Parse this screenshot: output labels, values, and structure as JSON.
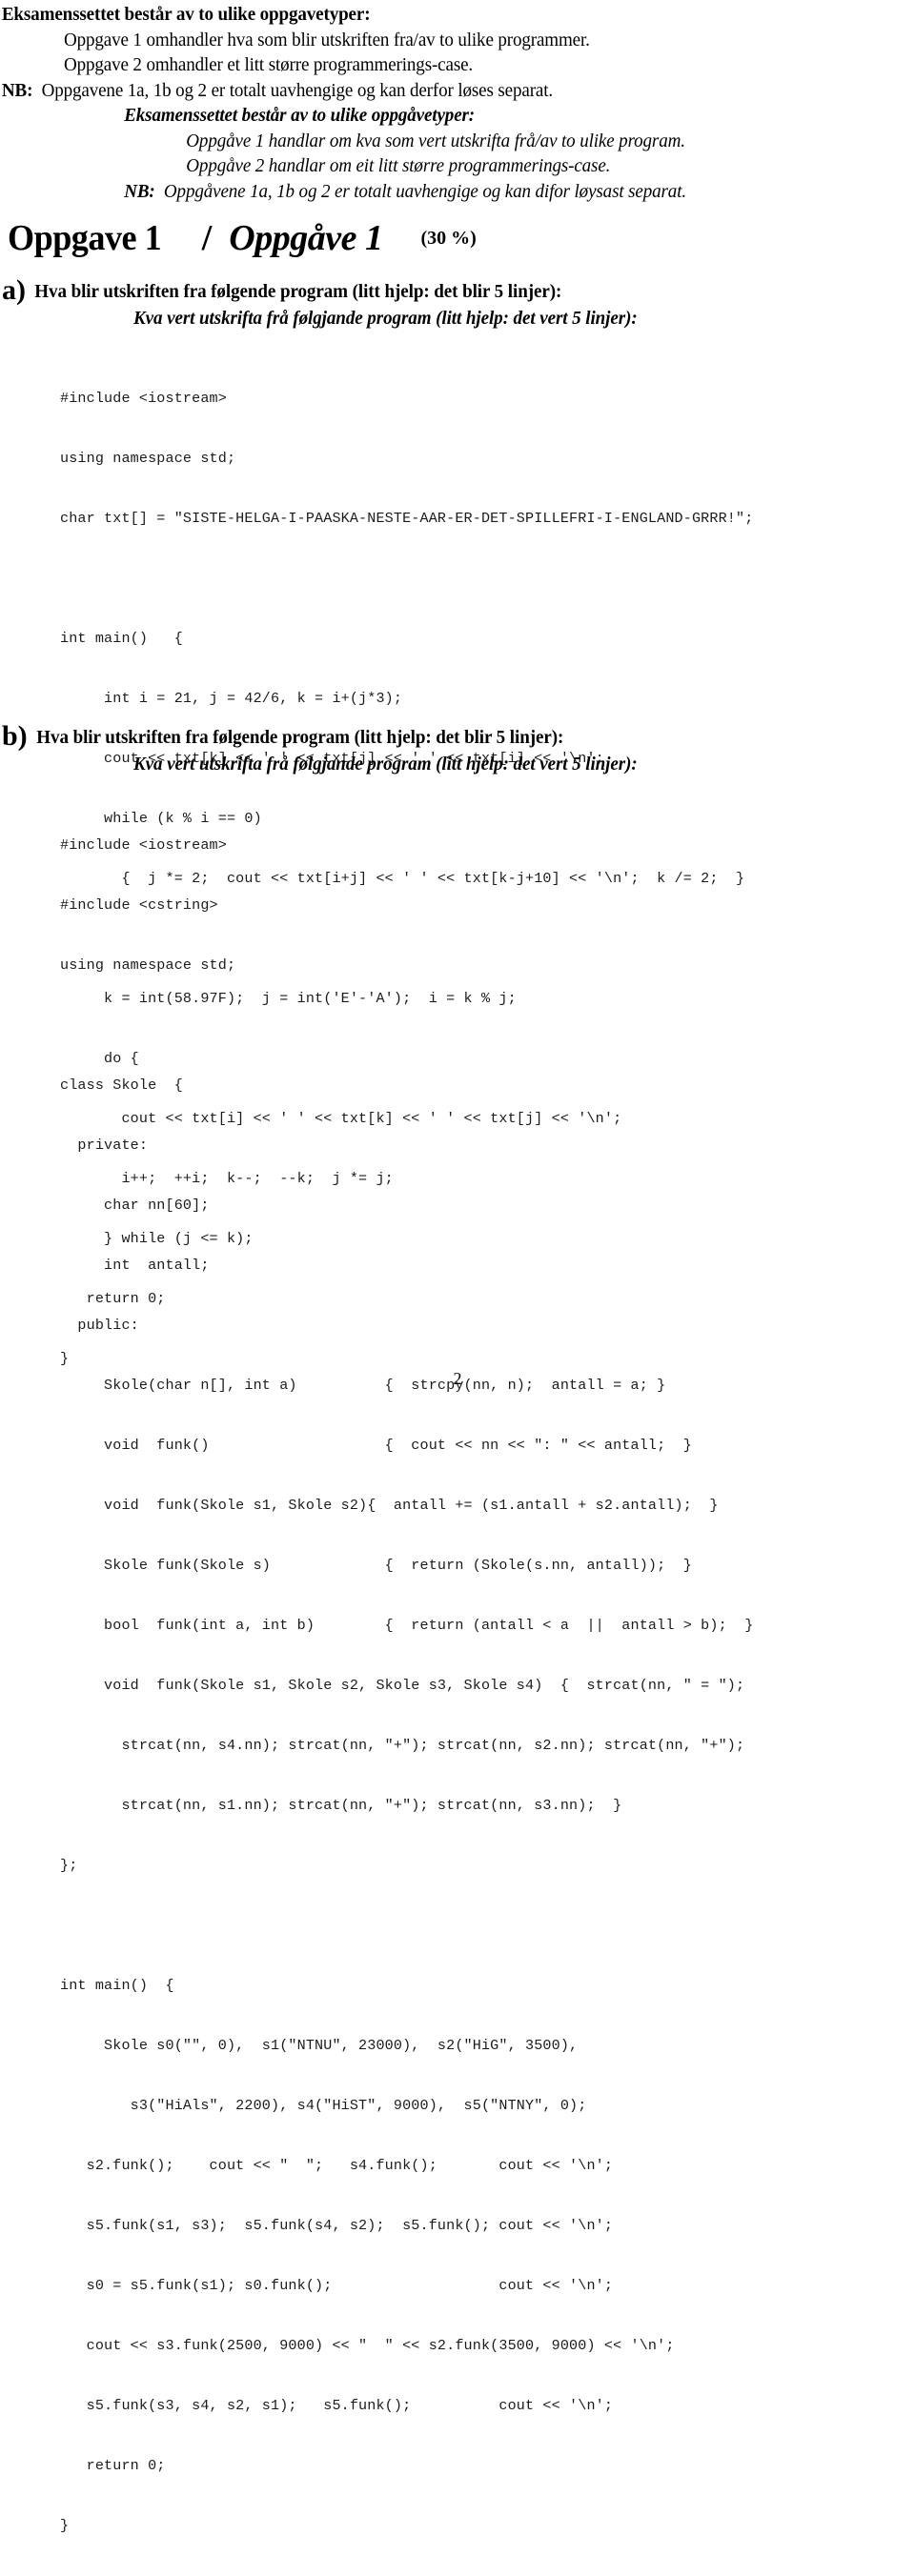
{
  "document": {
    "page_number": "2"
  },
  "intro": {
    "bokmal": {
      "heading": "Eksamenssettet består av to ulike oppgavetyper:",
      "line1": "Oppgave 1 omhandler hva som blir utskriften fra/av to ulike programmer.",
      "line2": "Oppgave 2 omhandler et litt større programmerings-case.",
      "nb_label": "NB:",
      "nb_text": "Oppgavene 1a, 1b og 2 er totalt uavhengige og kan derfor løses separat."
    },
    "nynorsk": {
      "heading": "Eksamenssettet består av to ulike oppgåvetyper:",
      "line1": "Oppgåve 1 handlar om kva som vert utskrifta frå/av to ulike program.",
      "line2": "Oppgåve 2 handlar om eit litt større programmerings-case.",
      "nb_label": "NB:",
      "nb_text": "Oppgåvene 1a, 1b og 2 er totalt uavhengige og kan difor løysast separat."
    }
  },
  "title": {
    "bokmal": "Oppgave 1",
    "separator": "/",
    "nynorsk": "Oppgåve 1",
    "weight": "(30 %)"
  },
  "question_a": {
    "letter": "a)",
    "bokmal": "Hva blir utskriften fra følgende program (litt hjelp: det blir 5 linjer):",
    "nynorsk": "Kva vert utskrifta frå følgjande program (litt hjelp: det vert 5 linjer):",
    "code": [
      "#include <iostream>",
      "using namespace std;",
      "char txt[] = \"SISTE-HELGA-I-PAASKA-NESTE-AAR-ER-DET-SPILLEFRI-I-ENGLAND-GRRR!\";",
      "",
      "int main()   {",
      "     int i = 21, j = 42/6, k = i+(j*3);",
      "     cout << txt[k] << ' ' << txt[j] << ' ' << txt[i] << '\\n';",
      "     while (k % i == 0)",
      "       {  j *= 2;  cout << txt[i+j] << ' ' << txt[k-j+10] << '\\n';  k /= 2;  }",
      "",
      "     k = int(58.97F);  j = int('E'-'A');  i = k % j;",
      "     do {",
      "       cout << txt[i] << ' ' << txt[k] << ' ' << txt[j] << '\\n';",
      "       i++;  ++i;  k--;  --k;  j *= j;",
      "     } while (j <= k);",
      "   return 0;",
      "}"
    ]
  },
  "question_b": {
    "letter": "b)",
    "bokmal": "Hva blir utskriften fra følgende program (litt hjelp: det blir 5 linjer):",
    "nynorsk": "Kva vert utskrifta frå følgjande program (litt hjelp: det vert 5 linjer):",
    "code": [
      "#include <iostream>",
      "#include <cstring>",
      "using namespace std;",
      "",
      "class Skole  {",
      "  private:",
      "     char nn[60];",
      "     int  antall;",
      "  public:",
      "     Skole(char n[], int a)          {  strcpy(nn, n);  antall = a; }",
      "     void  funk()                    {  cout << nn << \": \" << antall;  }",
      "     void  funk(Skole s1, Skole s2){  antall += (s1.antall + s2.antall);  }",
      "     Skole funk(Skole s)             {  return (Skole(s.nn, antall));  }",
      "     bool  funk(int a, int b)        {  return (antall < a  ||  antall > b);  }",
      "     void  funk(Skole s1, Skole s2, Skole s3, Skole s4)  {  strcat(nn, \" = \");",
      "       strcat(nn, s4.nn); strcat(nn, \"+\"); strcat(nn, s2.nn); strcat(nn, \"+\");",
      "       strcat(nn, s1.nn); strcat(nn, \"+\"); strcat(nn, s3.nn);  }",
      "};",
      "",
      "int main()  {",
      "     Skole s0(\"\", 0),  s1(\"NTNU\", 23000),  s2(\"HiG\", 3500),",
      "        s3(\"HiAls\", 2200), s4(\"HiST\", 9000),  s5(\"NTNY\", 0);",
      "   s2.funk();    cout << \"  \";   s4.funk();       cout << '\\n';",
      "   s5.funk(s1, s3);  s5.funk(s4, s2);  s5.funk(); cout << '\\n';",
      "   s0 = s5.funk(s1); s0.funk();                   cout << '\\n';",
      "   cout << s3.funk(2500, 9000) << \"  \" << s2.funk(3500, 9000) << '\\n';",
      "   s5.funk(s3, s4, s2, s1);   s5.funk();          cout << '\\n';",
      "   return 0;",
      "}"
    ]
  }
}
